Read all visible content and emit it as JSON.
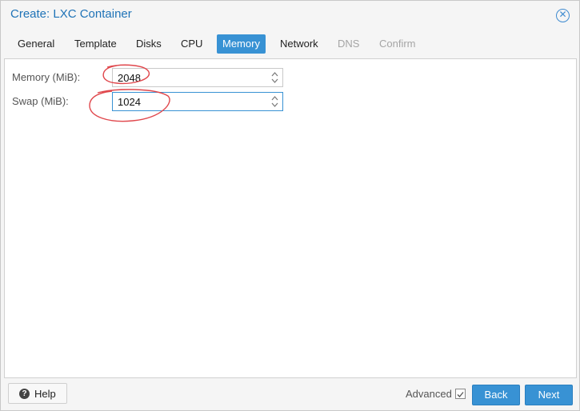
{
  "window": {
    "title": "Create: LXC Container",
    "close_icon": "close-icon",
    "accent": "#3892d4"
  },
  "tabs": [
    {
      "label": "General",
      "state": "normal"
    },
    {
      "label": "Template",
      "state": "normal"
    },
    {
      "label": "Disks",
      "state": "normal"
    },
    {
      "label": "CPU",
      "state": "normal"
    },
    {
      "label": "Memory",
      "state": "active"
    },
    {
      "label": "Network",
      "state": "normal"
    },
    {
      "label": "DNS",
      "state": "disabled"
    },
    {
      "label": "Confirm",
      "state": "disabled"
    }
  ],
  "form": {
    "memory": {
      "label": "Memory (MiB):",
      "value": "2048"
    },
    "swap": {
      "label": "Swap (MiB):",
      "value": "1024"
    }
  },
  "footer": {
    "help_label": "Help",
    "help_icon": "question-circle-icon",
    "advanced_label": "Advanced",
    "advanced_checked": true,
    "back_label": "Back",
    "next_label": "Next"
  },
  "annotation_color": "#e0474c"
}
